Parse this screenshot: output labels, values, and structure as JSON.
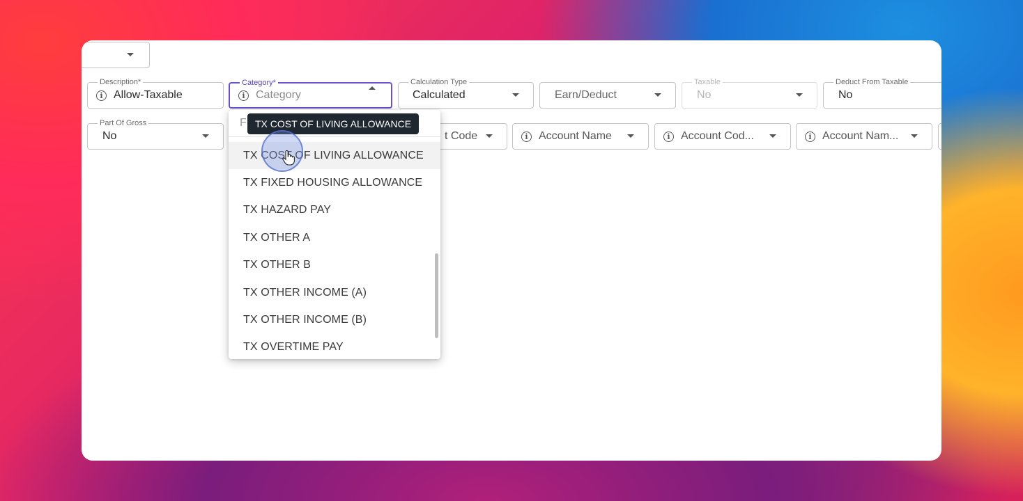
{
  "form": {
    "row1": {
      "description": {
        "label": "Description*",
        "value": "Allow-Taxable"
      },
      "category": {
        "label": "Category*",
        "placeholder": "Category"
      },
      "calculation_type": {
        "label": "Calculation Type",
        "value": "Calculated"
      },
      "earn_deduct": {
        "value": "Earn/Deduct"
      },
      "taxable": {
        "label": "Taxable",
        "value": "No"
      },
      "deduct_from_taxable": {
        "label": "Deduct From Taxable",
        "value": "No"
      }
    },
    "row2": {
      "part_of_gross": {
        "label": "Part Of Gross",
        "value": "No"
      },
      "account_code_1": {
        "value": "t Code"
      },
      "account_name_1": {
        "value": "Account Name"
      },
      "account_code_2": {
        "value": "Account Cod..."
      },
      "account_name_2": {
        "value": "Account Nam..."
      }
    }
  },
  "dropdown": {
    "filter_placeholder": "F",
    "options": [
      "TX COST OF LIVING ALLOWANCE",
      "TX FIXED HOUSING ALLOWANCE",
      "TX HAZARD PAY",
      "TX OTHER A",
      "TX OTHER B",
      "TX OTHER INCOME (A)",
      "TX OTHER INCOME (B)",
      "TX OVERTIME PAY"
    ],
    "tooltip": "TX COST OF LIVING ALLOWANCE"
  },
  "icons": {
    "info": "info-icon",
    "dropdown": "chevron-down-icon",
    "cursor": "hand-pointer-icon"
  },
  "colors": {
    "focus": "#6b4fd1",
    "tooltip_bg": "#1f2730"
  }
}
